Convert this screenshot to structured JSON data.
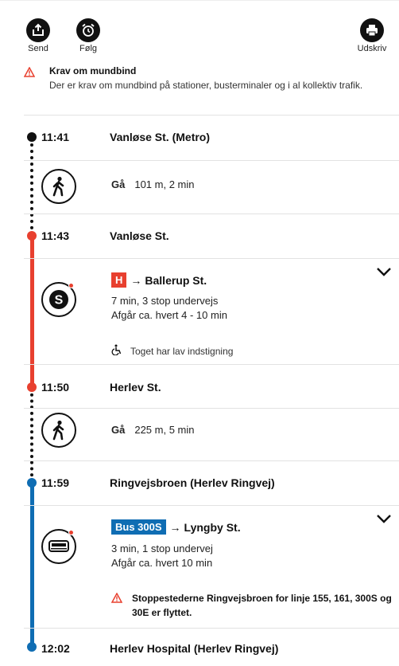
{
  "toolbar": {
    "send_label": "Send",
    "follow_label": "Følg",
    "print_label": "Udskriv"
  },
  "notice": {
    "title": "Krav om mundbind",
    "text": "Der er krav om mundbind på stationer, busterminaler og i al kollektiv trafik."
  },
  "colors": {
    "metro": "#111111",
    "s_train": "#e8402f",
    "bus": "#0f6db3"
  },
  "stops": [
    {
      "time": "11:41",
      "name": "Vanløse St. (Metro)"
    },
    {
      "time": "11:43",
      "name": "Vanløse St."
    },
    {
      "time": "11:50",
      "name": "Herlev St."
    },
    {
      "time": "11:59",
      "name": "Ringvejsbroen (Herlev Ringvej)"
    },
    {
      "time": "12:02",
      "name": "Herlev Hospital (Herlev Ringvej)"
    }
  ],
  "legs": [
    {
      "icon": "walk-icon",
      "label": "Gå",
      "detail": "101 m, 2 min"
    },
    {
      "icon": "s-train-icon",
      "line_badge": "H",
      "arrow": "→",
      "destination": "Ballerup St.",
      "duration": "7 min, 3 stop undervejs",
      "frequency": "Afgår ca. hvert 4 - 10 min",
      "note": "Toget har lav indstigning"
    },
    {
      "icon": "walk-icon",
      "label": "Gå",
      "detail": "225 m, 5 min"
    },
    {
      "icon": "bus-icon",
      "line_badge": "Bus 300S",
      "arrow": "→",
      "destination": "Lyngby St.",
      "duration": "3 min, 1 stop undervej",
      "frequency": "Afgår ca. hvert 10 min",
      "alert": "Stoppestederne Ringvejsbroen for linje 155, 161, 300S og 30E er flyttet."
    }
  ]
}
